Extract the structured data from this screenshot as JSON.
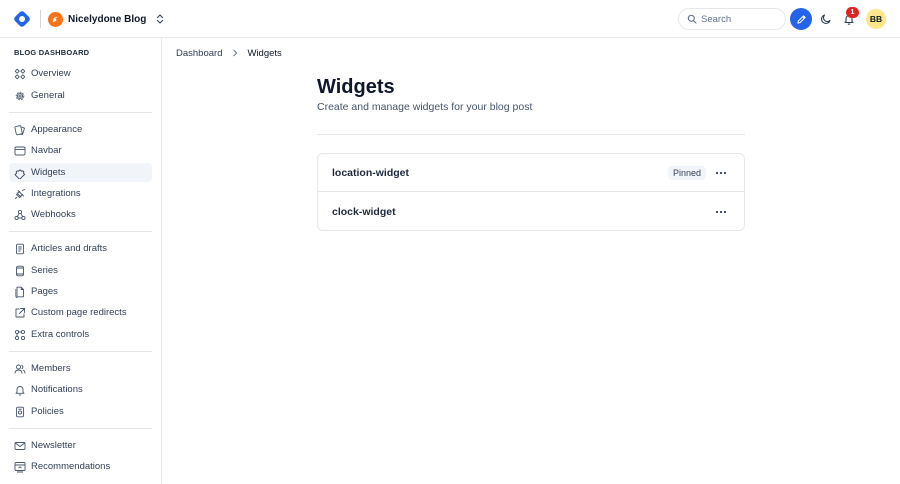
{
  "topbar": {
    "blog_name": "Nicelydone Blog",
    "search_placeholder": "Search",
    "notification_count": "1",
    "user_initials": "BB"
  },
  "sidebar": {
    "section_title": "BLOG DASHBOARD",
    "groups": [
      [
        {
          "label": "Overview",
          "icon": "grid-icon"
        },
        {
          "label": "General",
          "icon": "gear-icon"
        }
      ],
      [
        {
          "label": "Appearance",
          "icon": "paint-icon"
        },
        {
          "label": "Navbar",
          "icon": "navbar-icon"
        },
        {
          "label": "Widgets",
          "icon": "puzzle-icon",
          "active": true
        },
        {
          "label": "Integrations",
          "icon": "plug-icon"
        },
        {
          "label": "Webhooks",
          "icon": "webhook-icon"
        }
      ],
      [
        {
          "label": "Articles and drafts",
          "icon": "document-icon"
        },
        {
          "label": "Series",
          "icon": "book-icon"
        },
        {
          "label": "Pages",
          "icon": "pages-icon"
        },
        {
          "label": "Custom page redirects",
          "icon": "external-link-icon"
        },
        {
          "label": "Extra controls",
          "icon": "controls-icon"
        }
      ],
      [
        {
          "label": "Members",
          "icon": "users-icon"
        },
        {
          "label": "Notifications",
          "icon": "bell-icon"
        },
        {
          "label": "Policies",
          "icon": "policy-icon"
        }
      ],
      [
        {
          "label": "Newsletter",
          "icon": "mail-icon"
        },
        {
          "label": "Recommendations",
          "icon": "recommend-icon"
        }
      ]
    ]
  },
  "breadcrumb": {
    "parent": "Dashboard",
    "current": "Widgets"
  },
  "main": {
    "title": "Widgets",
    "subtitle": "Create and manage widgets for your blog post",
    "widgets": [
      {
        "name": "location-widget",
        "badge": "Pinned"
      },
      {
        "name": "clock-widget",
        "badge": ""
      }
    ]
  },
  "colors": {
    "accent": "#2563eb",
    "brand_orange": "#f97316",
    "badge_red": "#dc2626",
    "avatar_bg": "#fde68a"
  }
}
